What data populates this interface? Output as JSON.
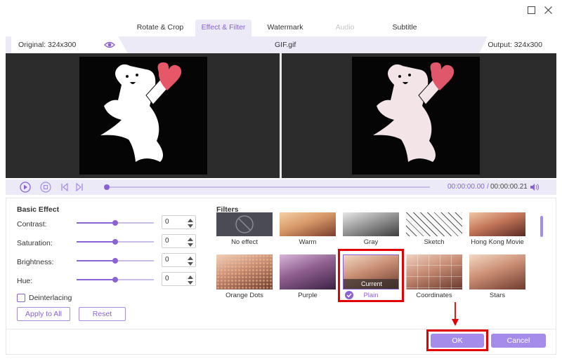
{
  "window": {
    "maximize_icon": "maximize-icon",
    "close_icon": "close-icon"
  },
  "tabs": [
    {
      "label": "Rotate & Crop"
    },
    {
      "label": "Effect & Filter"
    },
    {
      "label": "Watermark"
    },
    {
      "label": "Audio"
    },
    {
      "label": "Subtitle"
    }
  ],
  "info": {
    "original": "Original: 324x300",
    "filename": "GIF.gif",
    "output": "Output: 324x300"
  },
  "player": {
    "time_current": "00:00:00.00",
    "time_sep": "/",
    "time_total": "00:00:00.21"
  },
  "basic_effect": {
    "title": "Basic Effect",
    "rows": [
      {
        "label": "Contrast:",
        "value": "0"
      },
      {
        "label": "Saturation:",
        "value": "0"
      },
      {
        "label": "Brightness:",
        "value": "0"
      },
      {
        "label": "Hue:",
        "value": "0"
      }
    ],
    "deinterlacing": "Deinterlacing",
    "apply_all": "Apply to All",
    "reset": "Reset"
  },
  "filters": {
    "title": "Filters",
    "items": [
      {
        "name": "No effect"
      },
      {
        "name": "Warm"
      },
      {
        "name": "Gray"
      },
      {
        "name": "Sketch"
      },
      {
        "name": "Hong Kong Movie"
      },
      {
        "name": "Orange Dots"
      },
      {
        "name": "Purple"
      },
      {
        "name": "Plain",
        "badge": "Current"
      },
      {
        "name": "Coordinates"
      },
      {
        "name": "Stars"
      }
    ]
  },
  "footer": {
    "ok": "OK",
    "cancel": "Cancel"
  },
  "colors": {
    "accent": "#8b61d6",
    "highlight": "#e20000",
    "button": "#a58bea"
  }
}
